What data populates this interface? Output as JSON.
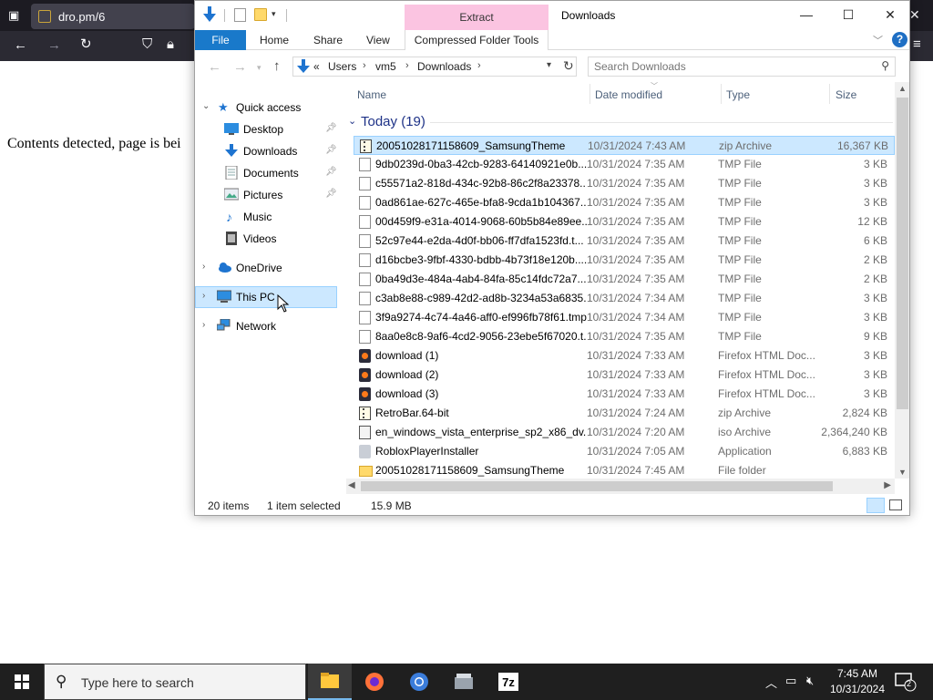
{
  "browser": {
    "tab_title": "dro.pm/6",
    "page_text": "Contents detected, page is bei"
  },
  "window": {
    "title": "Downloads",
    "contextual_tab": "Extract",
    "controls": {
      "minimize": "—",
      "maximize": "☐",
      "close": "✕"
    }
  },
  "ribbon": {
    "tabs": [
      "File",
      "Home",
      "Share",
      "View",
      "Compressed Folder Tools"
    ],
    "help": "?"
  },
  "address": {
    "prefix": "«",
    "crumbs": [
      "Users",
      "vm5",
      "Downloads"
    ]
  },
  "search": {
    "placeholder": "Search Downloads"
  },
  "nav": {
    "quick_access": "Quick access",
    "items": [
      "Desktop",
      "Downloads",
      "Documents",
      "Pictures",
      "Music",
      "Videos"
    ],
    "onedrive": "OneDrive",
    "this_pc": "This PC",
    "network": "Network"
  },
  "columns": {
    "name": "Name",
    "date": "Date modified",
    "type": "Type",
    "size": "Size"
  },
  "group": {
    "label": "Today (19)"
  },
  "files": [
    {
      "name": "20051028171158609_SamsungTheme",
      "date": "10/31/2024 7:43 AM",
      "type": "zip Archive",
      "size": "16,367 KB",
      "icon": "zip"
    },
    {
      "name": "9db0239d-0ba3-42cb-9283-64140921e0b...",
      "date": "10/31/2024 7:35 AM",
      "type": "TMP File",
      "size": "3 KB",
      "icon": "file"
    },
    {
      "name": "c55571a2-818d-434c-92b8-86c2f8a23378....",
      "date": "10/31/2024 7:35 AM",
      "type": "TMP File",
      "size": "3 KB",
      "icon": "file"
    },
    {
      "name": "0ad861ae-627c-465e-bfa8-9cda1b104367....",
      "date": "10/31/2024 7:35 AM",
      "type": "TMP File",
      "size": "3 KB",
      "icon": "file"
    },
    {
      "name": "00d459f9-e31a-4014-9068-60b5b84e89ee....",
      "date": "10/31/2024 7:35 AM",
      "type": "TMP File",
      "size": "12 KB",
      "icon": "file"
    },
    {
      "name": "52c97e44-e2da-4d0f-bb06-ff7dfa1523fd.t...",
      "date": "10/31/2024 7:35 AM",
      "type": "TMP File",
      "size": "6 KB",
      "icon": "file"
    },
    {
      "name": "d16bcbe3-9fbf-4330-bdbb-4b73f18e120b....",
      "date": "10/31/2024 7:35 AM",
      "type": "TMP File",
      "size": "2 KB",
      "icon": "file"
    },
    {
      "name": "0ba49d3e-484a-4ab4-84fa-85c14fdc72a7....",
      "date": "10/31/2024 7:35 AM",
      "type": "TMP File",
      "size": "2 KB",
      "icon": "file"
    },
    {
      "name": "c3ab8e88-c989-42d2-ad8b-3234a53a6835....",
      "date": "10/31/2024 7:34 AM",
      "type": "TMP File",
      "size": "3 KB",
      "icon": "file"
    },
    {
      "name": "3f9a9274-4c74-4a46-aff0-ef996fb78f61.tmp",
      "date": "10/31/2024 7:34 AM",
      "type": "TMP File",
      "size": "3 KB",
      "icon": "file"
    },
    {
      "name": "8aa0e8c8-9af6-4cd2-9056-23ebe5f67020.t...",
      "date": "10/31/2024 7:35 AM",
      "type": "TMP File",
      "size": "9 KB",
      "icon": "file"
    },
    {
      "name": "download (1)",
      "date": "10/31/2024 7:33 AM",
      "type": "Firefox HTML Doc...",
      "size": "3 KB",
      "icon": "html"
    },
    {
      "name": "download (2)",
      "date": "10/31/2024 7:33 AM",
      "type": "Firefox HTML Doc...",
      "size": "3 KB",
      "icon": "html"
    },
    {
      "name": "download (3)",
      "date": "10/31/2024 7:33 AM",
      "type": "Firefox HTML Doc...",
      "size": "3 KB",
      "icon": "html"
    },
    {
      "name": "RetroBar.64-bit",
      "date": "10/31/2024 7:24 AM",
      "type": "zip Archive",
      "size": "2,824 KB",
      "icon": "zip"
    },
    {
      "name": "en_windows_vista_enterprise_sp2_x86_dv...",
      "date": "10/31/2024 7:20 AM",
      "type": "iso Archive",
      "size": "2,364,240 KB",
      "icon": "iso"
    },
    {
      "name": "RobloxPlayerInstaller",
      "date": "10/31/2024 7:05 AM",
      "type": "Application",
      "size": "6,883 KB",
      "icon": "app"
    },
    {
      "name": "20051028171158609_SamsungTheme",
      "date": "10/31/2024 7:45 AM",
      "type": "File folder",
      "size": "",
      "icon": "folder"
    }
  ],
  "status": {
    "count": "20 items",
    "selected": "1 item selected",
    "size": "15.9 MB"
  },
  "taskbar": {
    "search_placeholder": "Type here to search",
    "time": "7:45 AM",
    "date": "10/31/2024",
    "notification_count": "2"
  },
  "colors": {
    "accent": "#1979ca",
    "selection": "#cce8ff",
    "selection_border": "#99d1ff",
    "extract_tab": "#fbc4e1",
    "group_header": "#1e3287"
  }
}
